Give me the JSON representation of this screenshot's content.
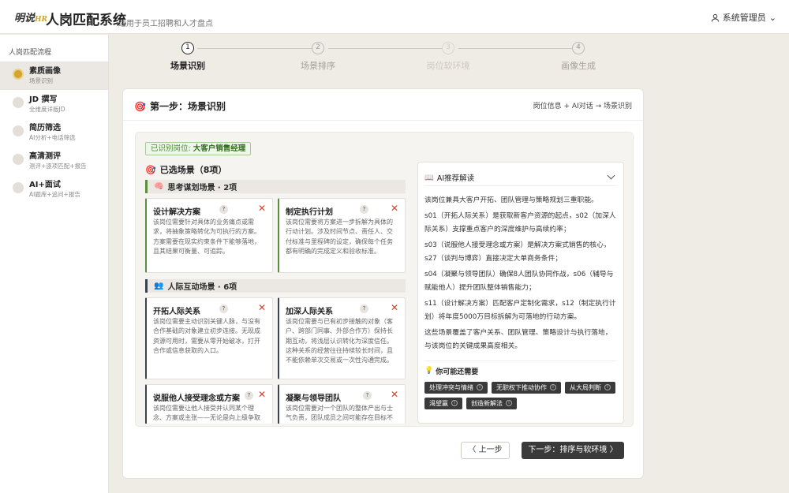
{
  "header": {
    "logo_text": "明说",
    "logo_suffix": "HR",
    "app_title": "人岗匹配系统",
    "app_subtitle": "适用于员工招聘和人才盘点",
    "user_name": "系统管理员"
  },
  "sidebar": {
    "heading": "人岗匹配流程",
    "items": [
      {
        "name": "素质画像",
        "desc": "场景识别",
        "active": true
      },
      {
        "name": "JD 撰写",
        "desc": "全维度详版JD",
        "active": false
      },
      {
        "name": "简历筛选",
        "desc": "AI分析+电话筛选",
        "active": false
      },
      {
        "name": "高清测评",
        "desc": "测评+逐项匹配+报告",
        "active": false
      },
      {
        "name": "AI+面试",
        "desc": "AI题库+追问+报告",
        "active": false
      }
    ]
  },
  "stepper": [
    {
      "num": "1",
      "label": "场景识别",
      "state": "active"
    },
    {
      "num": "2",
      "label": "场景排序",
      "state": "pending"
    },
    {
      "num": "3",
      "label": "岗位软环境",
      "state": "disabled"
    },
    {
      "num": "4",
      "label": "画像生成",
      "state": "pending"
    }
  ],
  "card": {
    "title": "第一步：场景识别",
    "path": "岗位信息 + AI对话 → 场景识别"
  },
  "position_tag": {
    "prefix": "已识别岗位:",
    "value": "大客户销售经理"
  },
  "selected_title": "已选场景（8项）",
  "groups": [
    {
      "title": "思考谋划场景 · 2项"
    },
    {
      "title": "人际互动场景 · 6项"
    }
  ],
  "scenes": [
    {
      "title": "设计解决方案",
      "desc": "该岗位需要针对具体的业务痛点或需求，将抽象策略转化为可执行的方案。方案需要在现实约束条件下能够落地，且其结果可衡量、可追踪。"
    },
    {
      "title": "制定执行计划",
      "desc": "该岗位需要将方案进一步拆解为具体的行动计划。涉及时间节点、责任人、交付标准与里程碑的设定，确保每个任务都有明确的完成定义和验收标准。"
    },
    {
      "title": "开拓人际关系",
      "desc": "该岗位需要主动识别关键人脉，与没有合作基础的对象建立初步连接。无现成资源可用时，需要从零开始破冰，打开合作或信息获取的入口。"
    },
    {
      "title": "加深人际关系",
      "desc": "该岗位需要与已有初步接触的对象（客户、跨部门同事、外部合作方）保持长期互动，将浅层认识转化为深度信任。这种关系的经营往往持续较长时间，且不能依赖单次交易或一次性沟通完成。"
    },
    {
      "title": "说服他人接受理念或方案",
      "desc": "该岗位需要让他人接受并认同某个理念、方案或主张——无论是向上级争取资源，还是向客户推介产品。"
    },
    {
      "title": "凝聚与领导团队",
      "desc": "该岗位需要对一个团队的整体产出与士气负责，团队成员之间可能存在目标不一致的情况。"
    }
  ],
  "ai_panel": {
    "title": "AI推荐解读",
    "paragraphs": [
      "该岗位兼具大客户开拓、团队管理与策略规划三重职能。",
      "s01（开拓人际关系）是获取新客户资源的起点，s02（加深人际关系）支撑重点客户的深度维护与高续约率；",
      "s03（说服他人接受理念或方案）是解决方案式销售的核心，s27（谈判与博弈）直接决定大单商务条件；",
      "s04（凝聚与领导团队）确保8人团队协同作战，s06（辅导与赋能他人）提升团队整体销售能力；",
      "s11（设计解决方案）匹配客户定制化需求，s12（制定执行计划）将年度5000万目标拆解为可落地的行动方案。",
      "这些场景覆盖了客户关系、团队管理、策略设计与执行落地，与该岗位的关键成果高度相关。"
    ],
    "tip_title": "你可能还需要",
    "chips": [
      "处理冲突与情绪",
      "无职权下推动协作",
      "从大局判断",
      "渴望赢",
      "创造新解法"
    ]
  },
  "buttons": {
    "prev": "〈 上一步",
    "next": "下一步：排序与软环境 〉"
  }
}
